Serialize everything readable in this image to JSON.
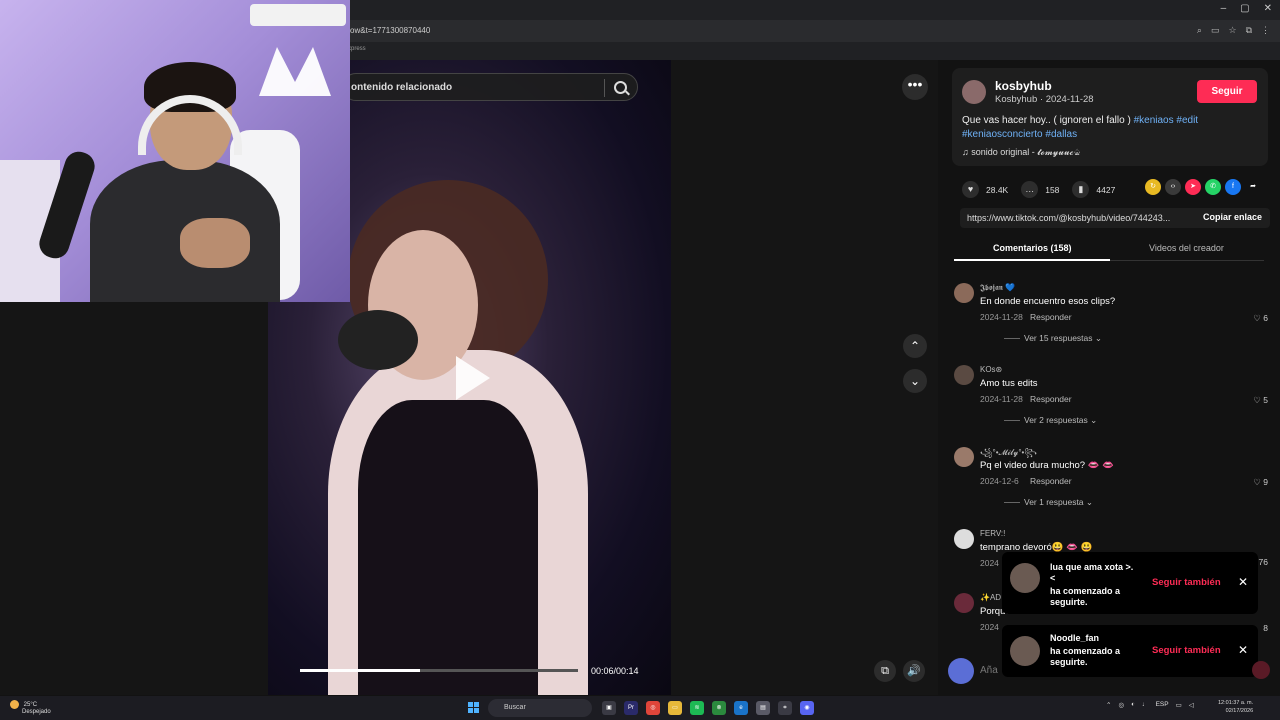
{
  "browser": {
    "url_fragment": "ow&t=1771300870440",
    "bookmark_fragment": "xpress",
    "window_controls": [
      "–",
      "▢",
      "✕"
    ]
  },
  "video": {
    "search_placeholder": "ontenido relacionado",
    "time": "00:06/00:14",
    "progress_fraction": 0.43
  },
  "author": {
    "username": "kosbyhub",
    "subline": "Kosbyhub · 2024-11-28",
    "follow_label": "Seguir",
    "caption_text": "Que vas hacer hoy.. ( ignoren el fallo ) ",
    "hashtags": [
      "#keniaos",
      "#edit",
      "#keniaosconcierto",
      "#dallas"
    ],
    "sound": "♫  sonido original - 𝓽𝓸𝓶𝔂𝓾𝓾𝓬♤"
  },
  "actions": {
    "likes": "28.4K",
    "comments": "158",
    "saves": "4427",
    "share_colors": [
      "#e8b923",
      "#3a3a3a",
      "#fe2c55",
      "#25d366",
      "#1877f2"
    ]
  },
  "link": {
    "url": "https://www.tiktok.com/@kosbyhub/video/744243...",
    "copy_label": "Copiar enlace"
  },
  "tabs": {
    "comments": "Comentarios (158)",
    "creator": "Videos del creador"
  },
  "comments": [
    {
      "user": "𝕵𝖇𝖔𝖏𝖆𝖓 💙",
      "text": "En donde encuentro esos clips?",
      "date": "2024-11-28",
      "reply": "Responder",
      "likes": "♡ 6",
      "more": "Ver 15 respuestas ⌄"
    },
    {
      "user": "KOs⊛",
      "text": "Amo tus edits",
      "date": "2024-11-28",
      "reply": "Responder",
      "likes": "♡ 5",
      "more": "Ver 2 respuestas ⌄"
    },
    {
      "user": "꧁°•𝓜𝓲𝓵𝔂°•꧂",
      "text": "Pq el video dura mucho? 👄 👄",
      "date": "2024-12-6",
      "reply": "Responder",
      "likes": "♡ 9",
      "more": "Ver 1 respuesta ⌄"
    },
    {
      "user": "FERV:!",
      "text": "temprano devoró😃 👄 😃",
      "date": "2024",
      "reply": "",
      "likes": "76",
      "more": ""
    },
    {
      "user": "✨AD",
      "text": "Porque no se viral?",
      "date": "2024",
      "reply": "",
      "likes": "8",
      "more": ""
    }
  ],
  "toasts": [
    {
      "name": "lua que ama xota >.",
      "line2": "<",
      "msg1": "ha comenzado a",
      "msg2": "seguirte.",
      "follow": "Seguir también",
      "close": "✕"
    },
    {
      "name": "Noodle_fan",
      "line2": "",
      "msg1": "ha comenzado a",
      "msg2": "seguirte.",
      "follow": "Seguir también",
      "close": "✕"
    }
  ],
  "comment_input": {
    "placeholder": "Aña"
  },
  "taskbar": {
    "weather_temp": "25°C",
    "weather_desc": "Despejado",
    "search_label": "Buscar",
    "lang": "ESP",
    "time": "12:01:37 a. m.",
    "date": "02/17/2026"
  }
}
